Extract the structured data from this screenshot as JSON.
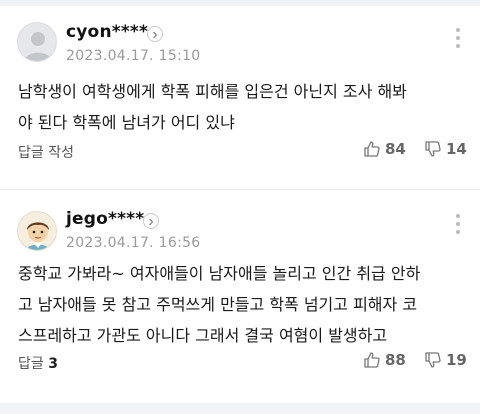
{
  "comments": [
    {
      "user": "cyon****",
      "timestamp": "2023.04.17. 15:10",
      "lines": [
        "남학생이 여학생에게 학폭 피해를 입은건 아닌지 조사 해봐",
        "야 된다 학폭에 남녀가 어디 있냐"
      ],
      "reply_label": "답글 작성",
      "reply_count": "",
      "likes": "84",
      "dislikes": "14"
    },
    {
      "user": "jego****",
      "timestamp": "2023.04.17. 16:56",
      "lines": [
        "중학교 가봐라~ 여자애들이 남자애들 놀리고 인간 취급 안하",
        "고 남자애들 못 참고 주먹쓰게 만들고 학폭 넘기고 피해자 코",
        "스프레하고 가관도 아니다 그래서 결국 여혐이 발생하고"
      ],
      "reply_label": "답글",
      "reply_count": "3",
      "likes": "88",
      "dislikes": "19"
    }
  ],
  "icons": {
    "avatar_default": "default-avatar-icon",
    "avatar_character": "character-avatar-icon",
    "like": "thumbs-up-icon",
    "dislike": "thumbs-down-icon",
    "more": "vertical-dots-icon",
    "chevron": "chevron-right-icon"
  },
  "colors": {
    "meta_gray": "#9a9a9a",
    "vote_gray": "#666666",
    "separator": "#f2f3f5"
  }
}
